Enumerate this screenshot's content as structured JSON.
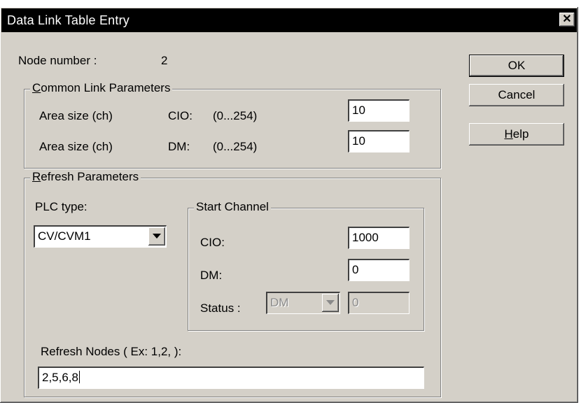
{
  "window": {
    "title": "Data Link Table Entry",
    "close_glyph": "✕"
  },
  "node": {
    "label": "Node number :",
    "value": "2"
  },
  "common": {
    "group_prefix": "",
    "group_mnemonic": "C",
    "group_rest": "ommon Link Parameters",
    "rows": [
      {
        "label": "Area size (ch)",
        "area": "CIO:",
        "range": "(0...254)",
        "value": "10"
      },
      {
        "label": "Area size (ch)",
        "area": "DM:",
        "range": "(0...254)",
        "value": "10"
      }
    ]
  },
  "refresh": {
    "group_mnemonic": "R",
    "group_rest": "efresh Parameters",
    "plc_type_label": "PLC  type:",
    "plc_type_value": "CV/CVM1",
    "start_channel": {
      "title": "Start Channel",
      "cio_label": "CIO:",
      "cio_value": "1000",
      "dm_label": "DM:",
      "dm_value": "0",
      "status_label": "Status :",
      "status_select": "DM",
      "status_value": "0"
    },
    "nodes_label": "Refresh Nodes ( Ex: 1,2, ):",
    "nodes_value": "2,5,6,8"
  },
  "buttons": {
    "ok": "OK",
    "cancel": "Cancel",
    "help_mnemonic": "H",
    "help_rest": "elp"
  },
  "icons": {
    "close": "close-icon",
    "dropdown": "chevron-down-icon"
  }
}
